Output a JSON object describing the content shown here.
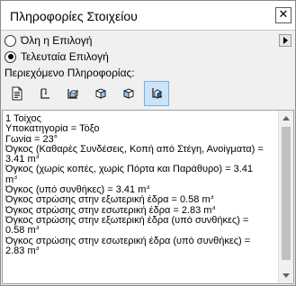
{
  "window": {
    "title": "Πληροφορίες Στοιχείου",
    "close_glyph": "✕"
  },
  "selection": {
    "options": [
      {
        "label": "Όλη η Επιλογή",
        "checked": false
      },
      {
        "label": "Τελευταία Επιλογή",
        "checked": true
      }
    ]
  },
  "content_label": "Περιεχόμενο Πληροφορίας:",
  "toolbar": {
    "buttons": [
      {
        "icon": "document-list-icon",
        "active": false
      },
      {
        "icon": "element-outline-icon",
        "active": false
      },
      {
        "icon": "element-section-icon",
        "active": false
      },
      {
        "icon": "element-3d-box-icon",
        "active": false
      },
      {
        "icon": "element-3d-side-icon",
        "active": false
      },
      {
        "icon": "element-3d-selected-icon",
        "active": true
      }
    ]
  },
  "info": {
    "lines": [
      "1 Τοίχος",
      "Υποκατηγορία = Τόξο",
      "Γωνία = 23°",
      "Όγκος (Καθαρές Συνδέσεις, Κοπή από Στέγη, Ανοίγματα) =",
      "3.41 m",
      "Όγκος (χωρίς κοπές, χωρίς Πόρτα και Παράθυρο) = 3.41",
      "m",
      "Όγκος (υπό συνθήκες) = 3.41 m",
      "Όγκος στρώσης στην εξωτερική έδρα = 0.58 m",
      "Όγκος στρώσης στην εσωτερική έδρα = 2.83 m",
      "Όγκος στρώσης στην εξωτερική έδρα (υπό συνθήκες) =",
      "0.58 m",
      "Όγκος στρώσης στην εσωτερική έδρα (υπό συνθήκες) =",
      "2.83 m"
    ],
    "cube_sup": "3"
  },
  "colors": {
    "active_tool_bg": "#cce4f7",
    "icon_blue": "#1e6fc0"
  }
}
